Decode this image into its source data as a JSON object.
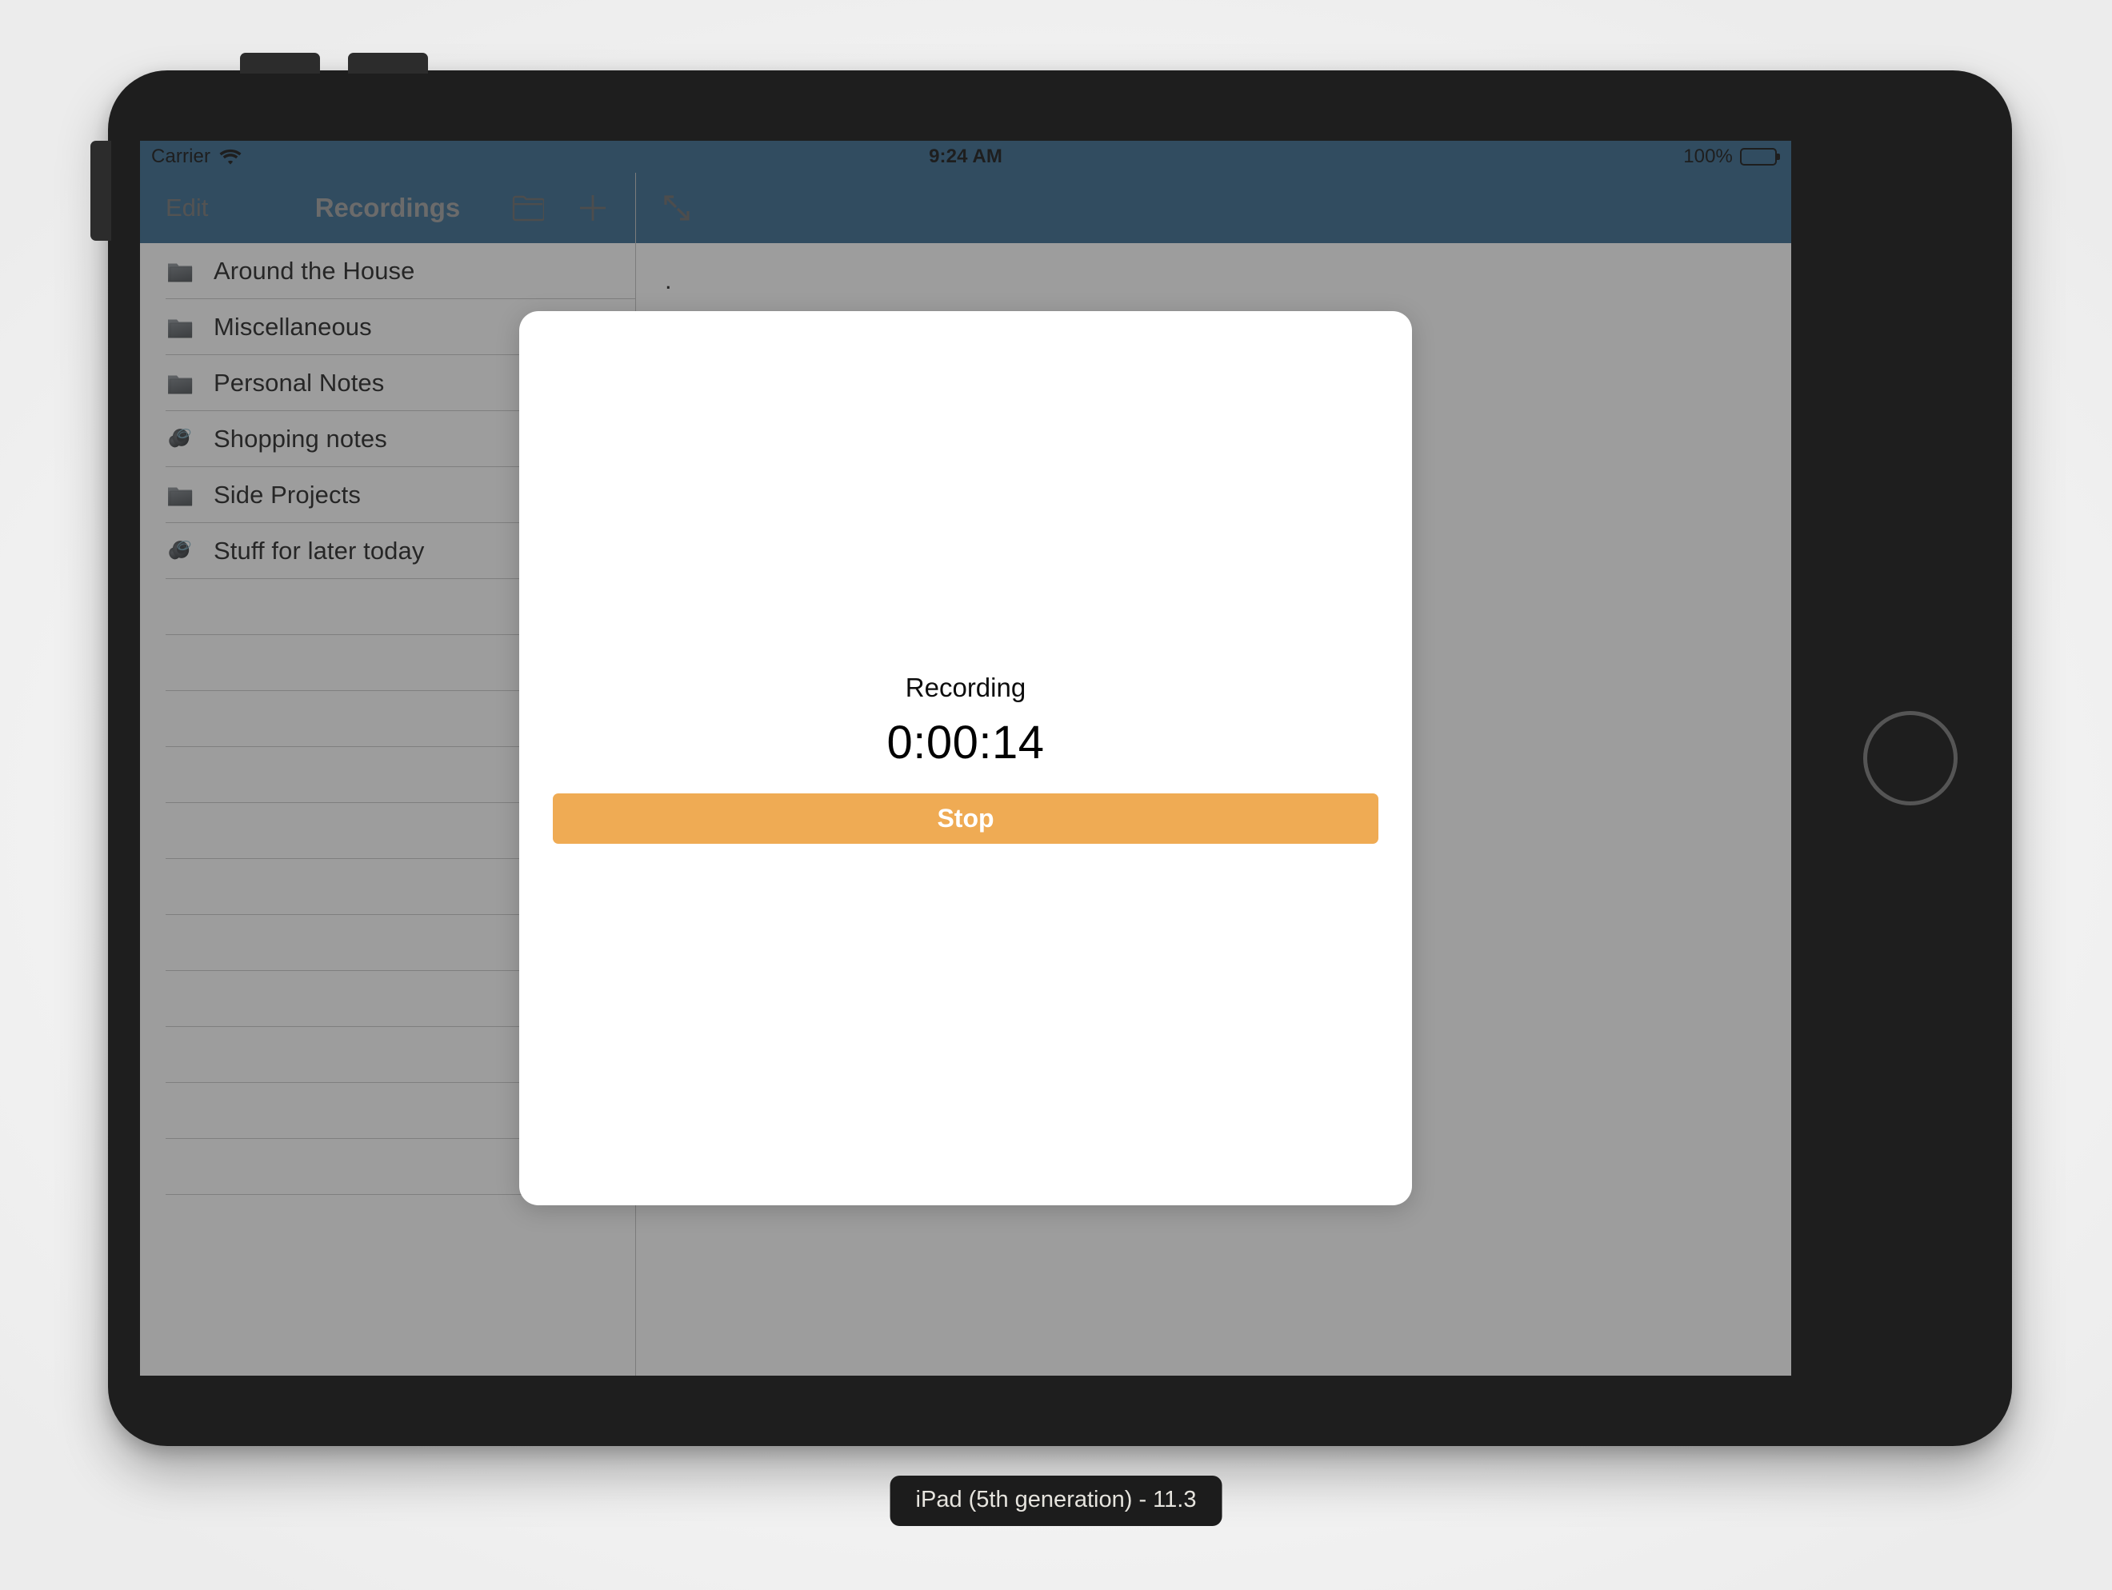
{
  "device": {
    "label": "iPad (5th generation) - 11.3",
    "home_button_icon": "home-button-circle-icon"
  },
  "statusbar": {
    "carrier": "Carrier",
    "wifi_icon": "wifi-icon",
    "time": "9:24 AM",
    "battery_percent": "100%",
    "battery_icon": "battery-full-icon"
  },
  "master_pane": {
    "navbar": {
      "edit_label": "Edit",
      "title": "Recordings",
      "new_folder_icon": "folder-icon",
      "add_icon": "plus-icon"
    },
    "rows": [
      {
        "label": "Around the House",
        "icon": "folder-icon"
      },
      {
        "label": "Miscellaneous",
        "icon": "folder-icon"
      },
      {
        "label": "Personal Notes",
        "icon": "folder-icon"
      },
      {
        "label": "Shopping notes",
        "icon": "speaker-icon"
      },
      {
        "label": "Side Projects",
        "icon": "folder-icon"
      },
      {
        "label": "Stuff for later today",
        "icon": "speaker-icon"
      }
    ],
    "empty_row_count": 11
  },
  "detail_pane": {
    "navbar": {
      "expand_icon": "expand-diagonal-arrows-icon"
    },
    "text": "."
  },
  "modal": {
    "status_label": "Recording",
    "timer": "0:00:14",
    "stop_label": "Stop"
  },
  "colors": {
    "navbar": "#265C85",
    "accent_orange": "#EFAB54",
    "bezel": "#1e1e1e",
    "dim_overlay": "rgba(60,60,60,0.50)"
  }
}
